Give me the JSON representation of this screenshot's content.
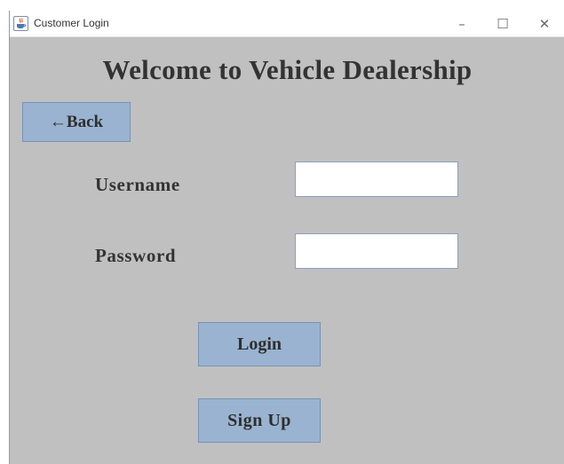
{
  "window": {
    "title": "Customer Login",
    "app_icon": "java-icon",
    "controls": {
      "minimize": "–",
      "maximize": "☐",
      "close": "✕"
    }
  },
  "heading": "Welcome to Vehicle Dealership",
  "back_button": {
    "label": "←Back"
  },
  "form": {
    "username": {
      "label": "Username",
      "value": "",
      "placeholder": ""
    },
    "password": {
      "label": "Password",
      "value": "",
      "placeholder": ""
    }
  },
  "login_button": {
    "label": "Login"
  },
  "signup_button": {
    "label": "Sign Up"
  },
  "colors": {
    "window_bg": "#c0c0c0",
    "button_bg": "#99b3d1",
    "button_border": "#7a93b3",
    "text": "#333333"
  }
}
